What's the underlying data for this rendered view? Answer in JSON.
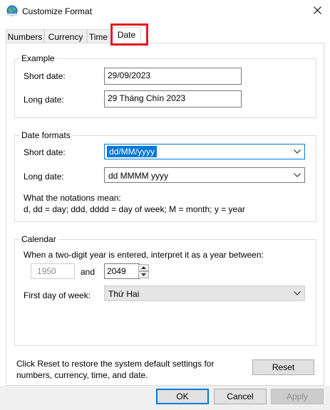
{
  "window": {
    "title": "Customize Format"
  },
  "tabs": [
    {
      "label": "Numbers"
    },
    {
      "label": "Currency"
    },
    {
      "label": "Time"
    },
    {
      "label": "Date",
      "active": true
    }
  ],
  "example": {
    "legend": "Example",
    "short_label": "Short date:",
    "short_value": "29/09/2023",
    "long_label": "Long date:",
    "long_value": "29 Tháng Chín 2023"
  },
  "formats": {
    "legend": "Date formats",
    "short_label": "Short date:",
    "short_value": "dd/MM/yyyy",
    "long_label": "Long date:",
    "long_value": "dd MMMM yyyy",
    "notation_title": "What the notations mean:",
    "notation_text": "d, dd = day;  ddd, dddd = day of week;  M = month;  y = year"
  },
  "calendar": {
    "legend": "Calendar",
    "two_digit_text": "When a two-digit year is entered, interpret it as a year between:",
    "year_from": "1950",
    "and_label": "and",
    "year_to": "2049",
    "first_day_label": "First day of week:",
    "first_day_value": "Thứ Hai"
  },
  "reset": {
    "text_line1": "Click Reset to restore the system default settings for",
    "text_line2": "numbers, currency, time, and date.",
    "button": "Reset"
  },
  "buttons": {
    "ok": "OK",
    "cancel": "Cancel",
    "apply": "Apply"
  },
  "colors": {
    "accent": "#0078d7",
    "highlight_border": "#e21b22"
  },
  "icons": [
    "globe-icon",
    "close-icon",
    "chevron-down-icon",
    "spin-up-icon",
    "spin-down-icon"
  ]
}
